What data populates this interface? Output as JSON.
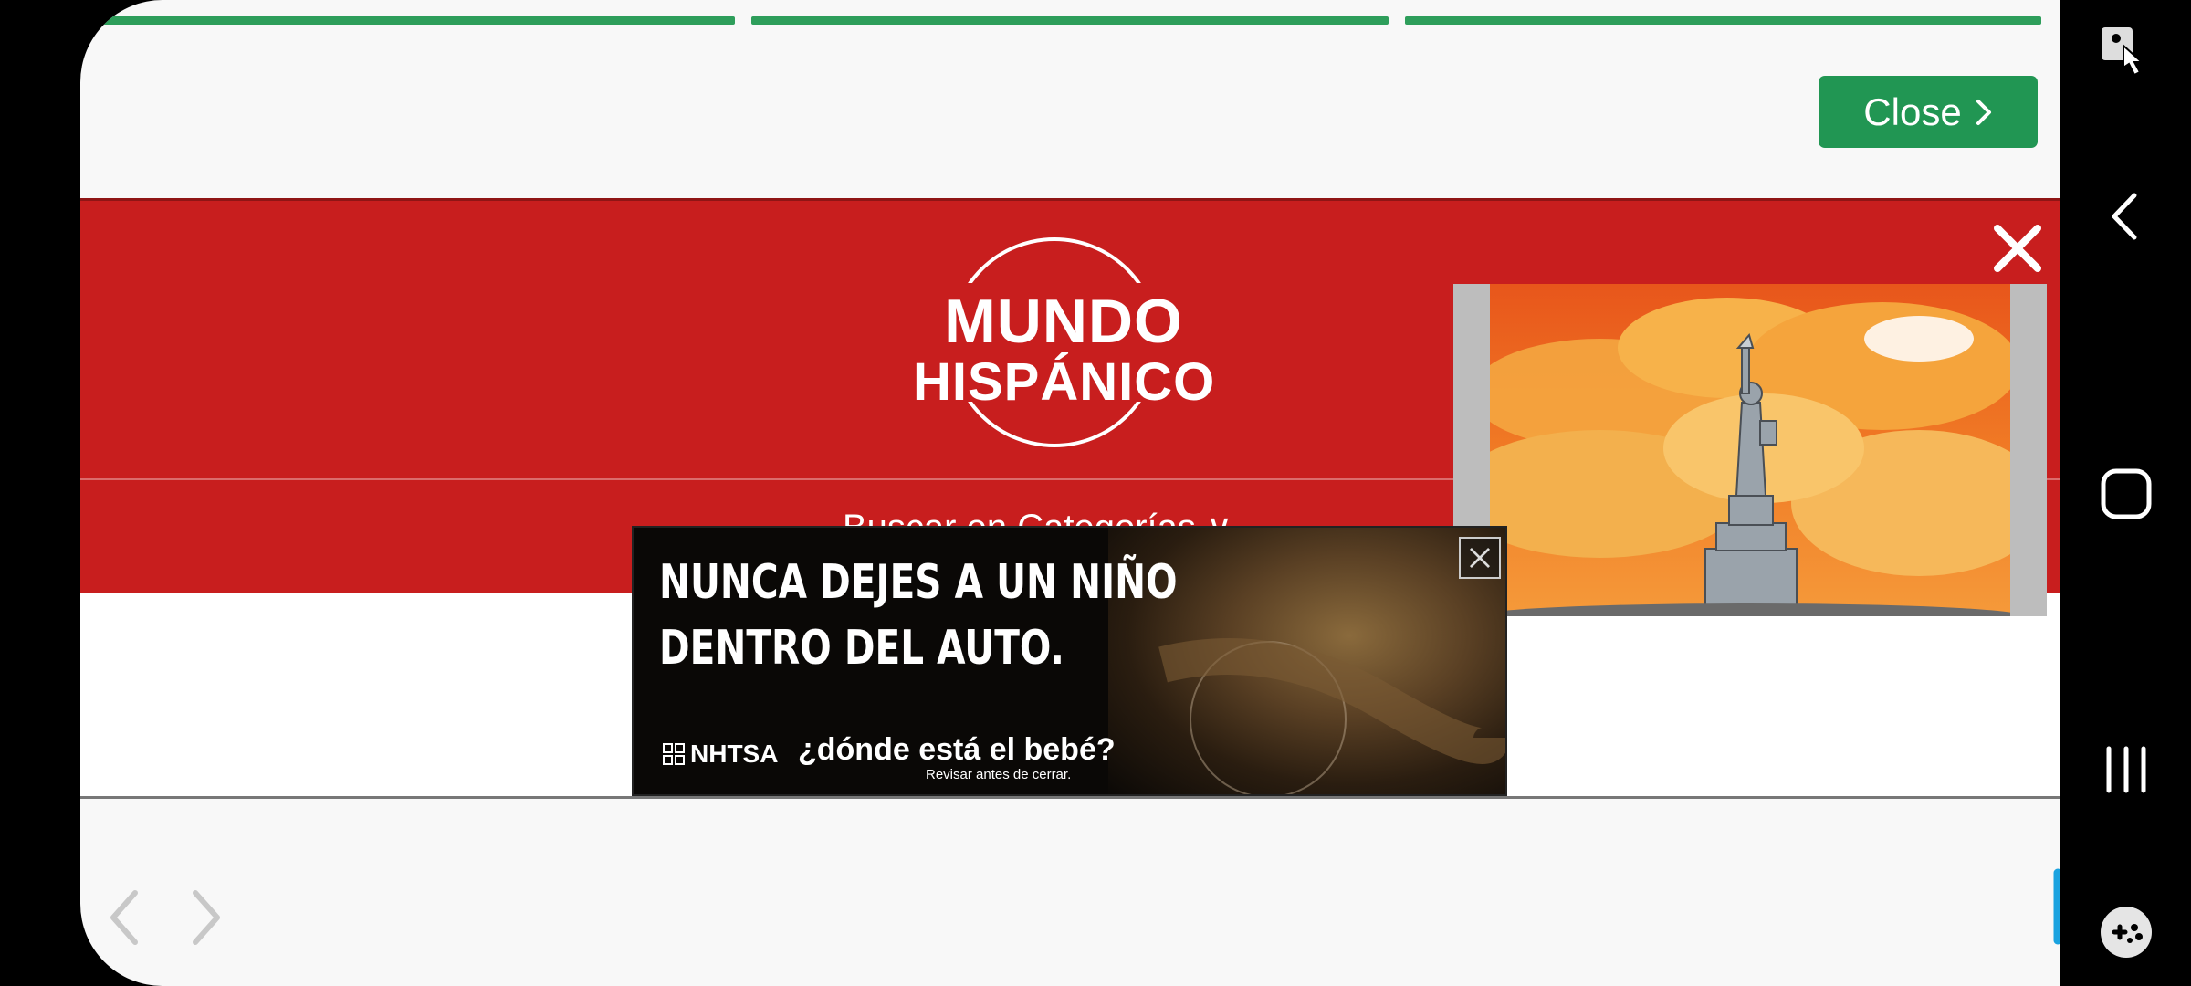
{
  "story": {
    "progress_bars": [
      1,
      1,
      1
    ]
  },
  "close_button": {
    "label": "Close"
  },
  "site": {
    "logo_line1": "MUNDO",
    "logo_line2": "HISPÁNICO",
    "category_search": "Buscar en Categorías ∨"
  },
  "banner_ad": {
    "headline_line1": "NUNCA DEJES A UN NIÑO",
    "headline_line2": "DENTRO DEL AUTO.",
    "sponsor": "NHTSA",
    "tagline": "¿dónde está el bebé?",
    "subtagline": "Revisar antes de cerrar."
  },
  "colors": {
    "brand_red": "#c81e1e",
    "close_green": "#219653",
    "progress_green": "#2e9e5b",
    "accent_blue": "#1aa3e0"
  }
}
